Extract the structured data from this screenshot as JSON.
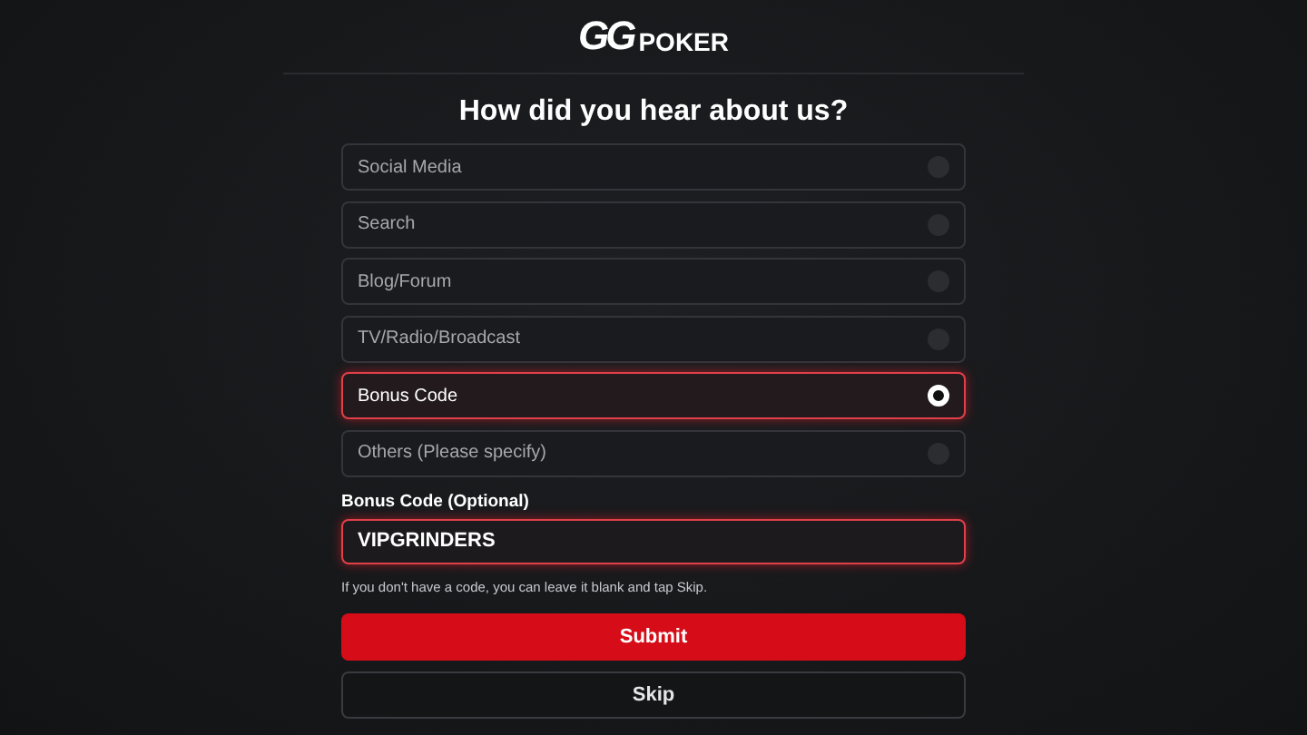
{
  "logo": {
    "mark": "GG",
    "word": "POKER"
  },
  "title": "How did you hear about us?",
  "options": [
    {
      "label": "Social Media",
      "selected": false
    },
    {
      "label": "Search",
      "selected": false
    },
    {
      "label": "Blog/Forum",
      "selected": false
    },
    {
      "label": "TV/Radio/Broadcast",
      "selected": false
    },
    {
      "label": "Bonus Code",
      "selected": true
    },
    {
      "label": "Others (Please specify)",
      "selected": false
    }
  ],
  "code_field": {
    "label": "Bonus Code (Optional)",
    "value": "VIPGRINDERS"
  },
  "hint": "If you don't have a code, you can leave it blank and tap Skip.",
  "buttons": [
    {
      "label": "Submit",
      "kind": "primary"
    },
    {
      "label": "Skip",
      "kind": "secondary"
    }
  ]
}
